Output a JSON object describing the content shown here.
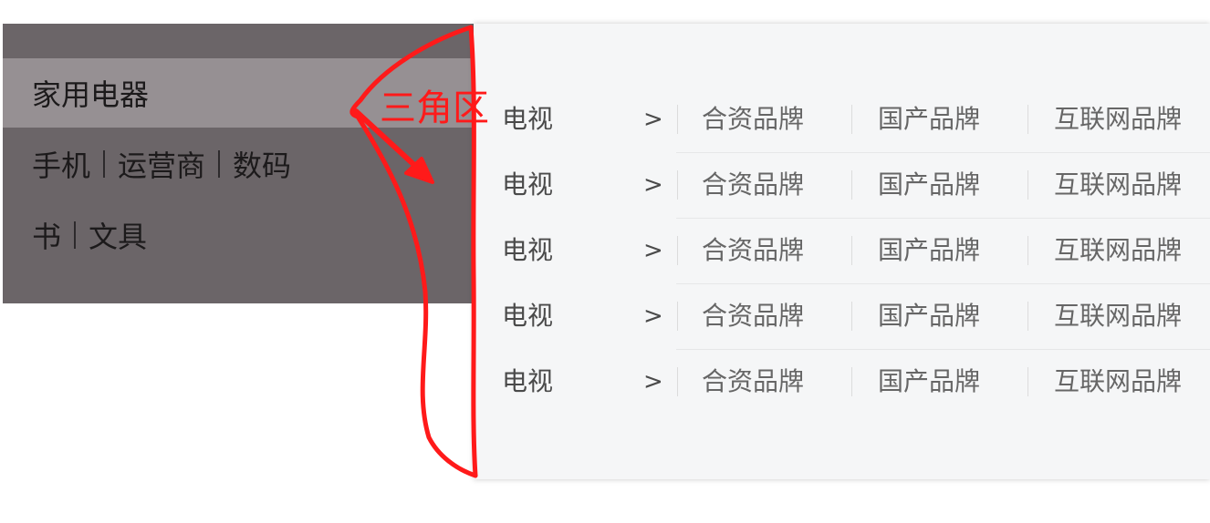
{
  "category_menu": {
    "items": [
      {
        "parts": [
          "家用电器"
        ],
        "active": true
      },
      {
        "parts": [
          "手机",
          "运营商",
          "数码"
        ],
        "active": false
      },
      {
        "parts": [
          "书",
          "文具"
        ],
        "active": false
      }
    ]
  },
  "submenu": {
    "rows": [
      {
        "title": "电视",
        "arrow": ">",
        "brands": [
          "合资品牌",
          "国产品牌",
          "互联网品牌"
        ]
      },
      {
        "title": "电视",
        "arrow": ">",
        "brands": [
          "合资品牌",
          "国产品牌",
          "互联网品牌"
        ]
      },
      {
        "title": "电视",
        "arrow": ">",
        "brands": [
          "合资品牌",
          "国产品牌",
          "互联网品牌"
        ]
      },
      {
        "title": "电视",
        "arrow": ">",
        "brands": [
          "合资品牌",
          "国产品牌",
          "互联网品牌"
        ]
      },
      {
        "title": "电视",
        "arrow": ">",
        "brands": [
          "合资品牌",
          "国产品牌",
          "互联网品牌"
        ]
      }
    ]
  },
  "annotation": {
    "label": "三角区",
    "color": "#ff1a1a"
  },
  "colors": {
    "menu_background": "#6b6568",
    "menu_active_background": "#969093",
    "panel_background": "#f5f6f7"
  }
}
